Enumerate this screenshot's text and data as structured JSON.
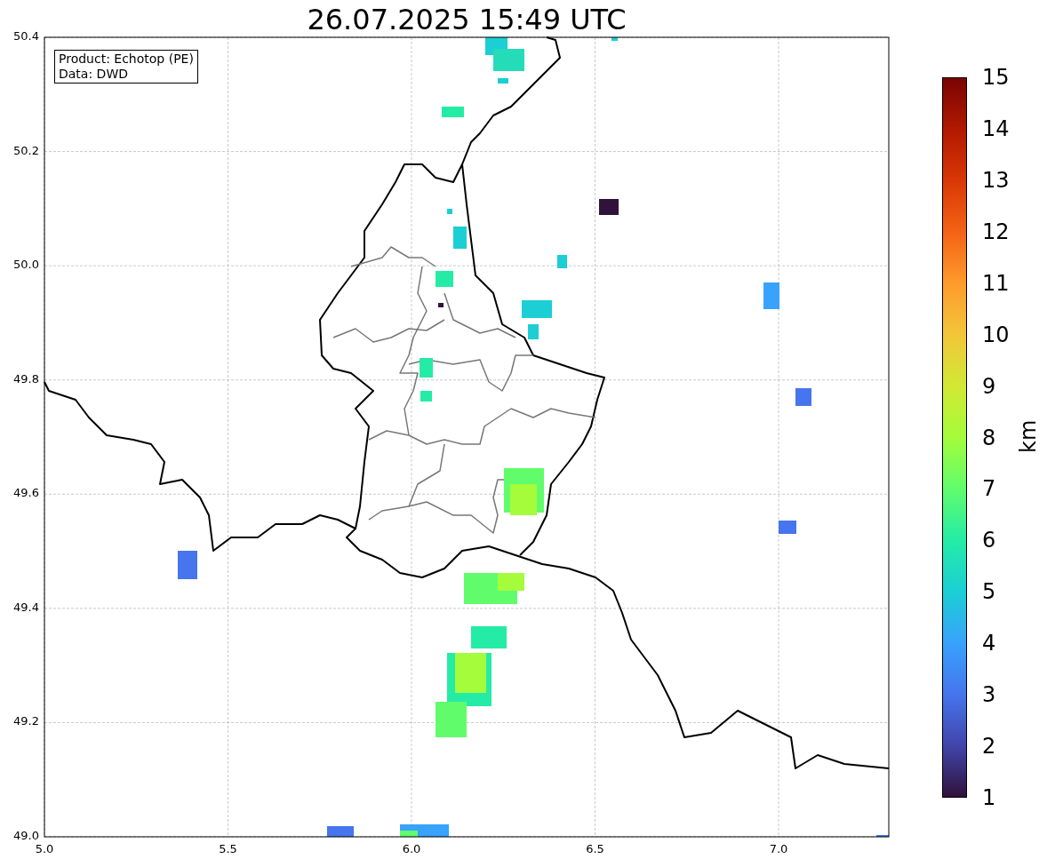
{
  "title": "26.07.2025 15:49 UTC",
  "info_box": [
    "Product: Echotop (PE)",
    "Data: DWD"
  ],
  "x_ticks": [
    "5.0",
    "5.5",
    "6.0",
    "6.5",
    "7.0"
  ],
  "y_ticks": [
    "50.4",
    "50.2",
    "50.0",
    "49.8",
    "49.6",
    "49.4",
    "49.2",
    "49.0"
  ],
  "colorbar": {
    "label": "km",
    "ticks": [
      "15",
      "14",
      "13",
      "12",
      "11",
      "10",
      "9",
      "8",
      "7",
      "6",
      "5",
      "4",
      "3",
      "2",
      "1"
    ]
  }
}
